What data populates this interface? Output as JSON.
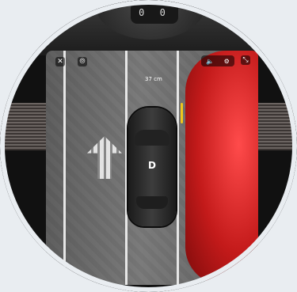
{
  "mirror": {
    "display": "0 0"
  },
  "camera_view": {
    "distance_label": "37 cm",
    "gear": "D",
    "controls": {
      "close_icon": "✕",
      "camera_icon": "⦾",
      "volume_icon": "🔈",
      "settings_icon": "⚙",
      "collapse_icon": "⤡"
    }
  },
  "colors": {
    "neighbor_car": "#d0201e",
    "guide_line": "#f0c51c",
    "background": "#e9edf1"
  }
}
